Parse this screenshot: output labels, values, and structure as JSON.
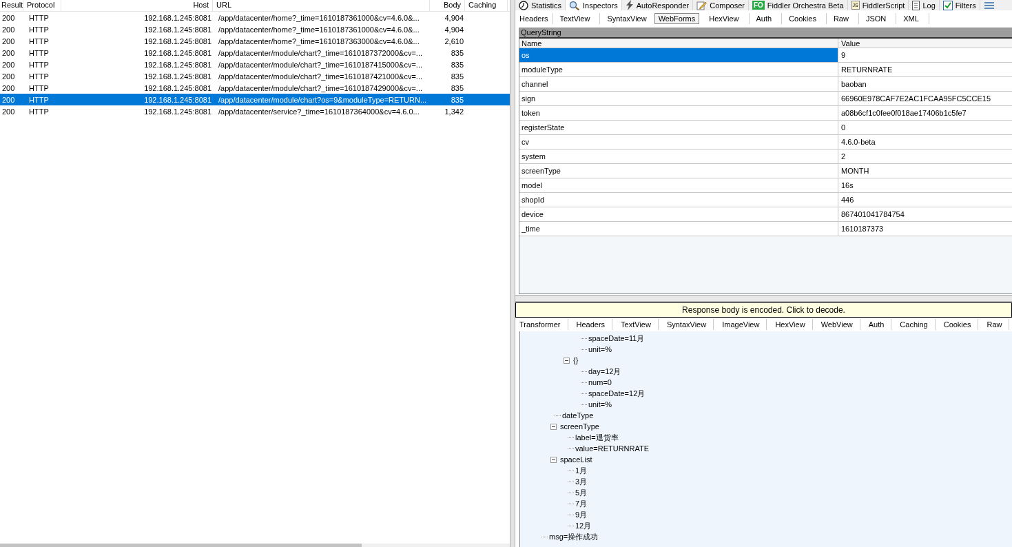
{
  "sessions": {
    "columns": [
      "Result",
      "Protocol",
      "Host",
      "URL",
      "Body",
      "Caching"
    ],
    "rows": [
      {
        "result": "200",
        "protocol": "HTTP",
        "host": "192.168.1.245:8081",
        "url": "/app/datacenter/home?_time=1610187361000&cv=4.6.0&...",
        "body": "4,904",
        "selected": false
      },
      {
        "result": "200",
        "protocol": "HTTP",
        "host": "192.168.1.245:8081",
        "url": "/app/datacenter/home?_time=1610187361000&cv=4.6.0&...",
        "body": "4,904",
        "selected": false
      },
      {
        "result": "200",
        "protocol": "HTTP",
        "host": "192.168.1.245:8081",
        "url": "/app/datacenter/home?_time=1610187363000&cv=4.6.0&...",
        "body": "2,610",
        "selected": false
      },
      {
        "result": "200",
        "protocol": "HTTP",
        "host": "192.168.1.245:8081",
        "url": "/app/datacenter/module/chart?_time=1610187372000&cv=...",
        "body": "835",
        "selected": false
      },
      {
        "result": "200",
        "protocol": "HTTP",
        "host": "192.168.1.245:8081",
        "url": "/app/datacenter/module/chart?_time=1610187415000&cv=...",
        "body": "835",
        "selected": false
      },
      {
        "result": "200",
        "protocol": "HTTP",
        "host": "192.168.1.245:8081",
        "url": "/app/datacenter/module/chart?_time=1610187421000&cv=...",
        "body": "835",
        "selected": false
      },
      {
        "result": "200",
        "protocol": "HTTP",
        "host": "192.168.1.245:8081",
        "url": "/app/datacenter/module/chart?_time=1610187429000&cv=...",
        "body": "835",
        "selected": false
      },
      {
        "result": "200",
        "protocol": "HTTP",
        "host": "192.168.1.245:8081",
        "url": "/app/datacenter/module/chart?os=9&moduleType=RETURN...",
        "body": "835",
        "selected": true
      },
      {
        "result": "200",
        "protocol": "HTTP",
        "host": "192.168.1.245:8081",
        "url": "/app/datacenter/service?_time=1610187364000&cv=4.6.0...",
        "body": "1,342",
        "selected": false
      }
    ]
  },
  "main_tabs": [
    {
      "label": "Statistics",
      "kind": "clock",
      "selected": false
    },
    {
      "label": "Inspectors",
      "kind": "magnifier",
      "selected": true
    },
    {
      "label": "AutoResponder",
      "kind": "bolt",
      "selected": false
    },
    {
      "label": "Composer",
      "kind": "pencil",
      "selected": false
    },
    {
      "label": "Fiddler Orchestra Beta",
      "kind": "badge",
      "icon_text": "FO",
      "selected": false
    },
    {
      "label": "FiddlerScript",
      "kind": "script",
      "icon_text": "JS",
      "selected": false
    },
    {
      "label": "Log",
      "kind": "doc",
      "selected": false
    },
    {
      "label": "Filters",
      "kind": "check",
      "selected": false
    }
  ],
  "request_tabs": [
    {
      "label": "Headers",
      "selected": false
    },
    {
      "label": "TextView",
      "selected": false
    },
    {
      "label": "SyntaxView",
      "selected": false
    },
    {
      "label": "WebForms",
      "selected": true
    },
    {
      "label": "HexView",
      "selected": false
    },
    {
      "label": "Auth",
      "selected": false
    },
    {
      "label": "Cookies",
      "selected": false
    },
    {
      "label": "Raw",
      "selected": false
    },
    {
      "label": "JSON",
      "selected": false
    },
    {
      "label": "XML",
      "selected": false
    }
  ],
  "query_string": {
    "title": "QueryString",
    "columns": [
      "Name",
      "Value"
    ],
    "rows": [
      {
        "name": "os",
        "value": "9",
        "selected": true
      },
      {
        "name": "moduleType",
        "value": "RETURNRATE",
        "selected": false
      },
      {
        "name": "channel",
        "value": "baoban",
        "selected": false
      },
      {
        "name": "sign",
        "value": "66960E978CAF7E2AC1FCAA95FC5CCE15",
        "selected": false
      },
      {
        "name": "token",
        "value": "a08b6cf1c0fee0f018ae17406b1c5fe7",
        "selected": false
      },
      {
        "name": "registerState",
        "value": "0",
        "selected": false
      },
      {
        "name": "cv",
        "value": "4.6.0-beta",
        "selected": false
      },
      {
        "name": "system",
        "value": "2",
        "selected": false
      },
      {
        "name": "screenType",
        "value": "MONTH",
        "selected": false
      },
      {
        "name": "model",
        "value": "16s",
        "selected": false
      },
      {
        "name": "shopId",
        "value": "446",
        "selected": false
      },
      {
        "name": "device",
        "value": "867401041784754",
        "selected": false
      },
      {
        "name": "_time",
        "value": "1610187373",
        "selected": false
      }
    ]
  },
  "response_notice": "Response body is encoded. Click to decode.",
  "response_tabs": [
    {
      "label": "Transformer",
      "selected": false
    },
    {
      "label": "Headers",
      "selected": false
    },
    {
      "label": "TextView",
      "selected": false
    },
    {
      "label": "SyntaxView",
      "selected": false
    },
    {
      "label": "ImageView",
      "selected": false
    },
    {
      "label": "HexView",
      "selected": false
    },
    {
      "label": "WebView",
      "selected": false
    },
    {
      "label": "Auth",
      "selected": false
    },
    {
      "label": "Caching",
      "selected": false
    },
    {
      "label": "Cookies",
      "selected": false
    },
    {
      "label": "Raw",
      "selected": false
    }
  ],
  "tree": [
    {
      "children": [
        {
          "children": [
            {
              "children": [
                {
                  "children": [
                    {
                      "label": "spaceDate=11月"
                    },
                    {
                      "label": "unit=%"
                    }
                  ]
                },
                {
                  "label": "{}",
                  "expanded": true,
                  "children": [
                    {
                      "label": "day=12月"
                    },
                    {
                      "label": "num=0"
                    },
                    {
                      "label": "spaceDate=12月"
                    },
                    {
                      "label": "unit=%"
                    }
                  ]
                }
              ]
            },
            {
              "label": "dateType"
            },
            {
              "label": "screenType",
              "expanded": true,
              "children": [
                {
                  "label": "label=退货率"
                },
                {
                  "label": "value=RETURNRATE"
                }
              ]
            },
            {
              "label": "spaceList",
              "expanded": true,
              "children": [
                {
                  "label": "1月"
                },
                {
                  "label": "3月"
                },
                {
                  "label": "5月"
                },
                {
                  "label": "7月"
                },
                {
                  "label": "9月"
                },
                {
                  "label": "12月"
                }
              ]
            }
          ]
        },
        {
          "label": "msg=操作成功"
        }
      ]
    }
  ]
}
